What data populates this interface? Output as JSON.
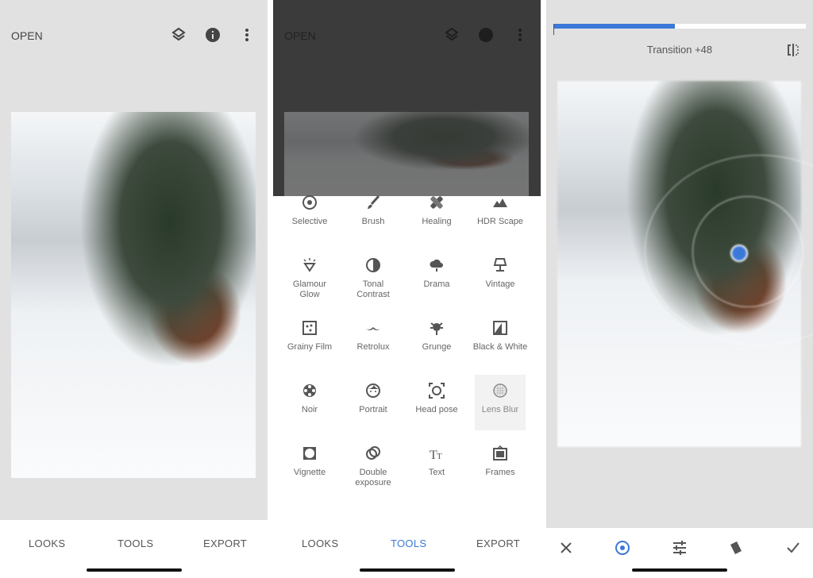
{
  "panel1": {
    "open_label": "OPEN",
    "tabs": [
      "LOOKS",
      "TOOLS",
      "EXPORT"
    ],
    "icons": [
      "layers-icon",
      "info-icon",
      "more-vert-icon"
    ]
  },
  "panel2": {
    "open_label": "OPEN",
    "tabs": [
      "LOOKS",
      "TOOLS",
      "EXPORT"
    ],
    "active_tab": "TOOLS",
    "tools": [
      {
        "label": "Selective",
        "icon": "selective-icon"
      },
      {
        "label": "Brush",
        "icon": "brush-icon"
      },
      {
        "label": "Healing",
        "icon": "healing-icon"
      },
      {
        "label": "HDR Scape",
        "icon": "mountains-icon"
      },
      {
        "label": "Glamour Glow",
        "icon": "diamond-icon"
      },
      {
        "label": "Tonal Contrast",
        "icon": "tonal-icon"
      },
      {
        "label": "Drama",
        "icon": "cloud-icon"
      },
      {
        "label": "Vintage",
        "icon": "lamp-icon"
      },
      {
        "label": "Grainy Film",
        "icon": "grain-icon"
      },
      {
        "label": "Retrolux",
        "icon": "mustache-icon"
      },
      {
        "label": "Grunge",
        "icon": "grunge-icon"
      },
      {
        "label": "Black & White",
        "icon": "bw-icon"
      },
      {
        "label": "Noir",
        "icon": "film-reel-icon"
      },
      {
        "label": "Portrait",
        "icon": "face-icon"
      },
      {
        "label": "Head pose",
        "icon": "face-frame-icon"
      },
      {
        "label": "Lens Blur",
        "icon": "lens-blur-icon"
      },
      {
        "label": "Vignette",
        "icon": "vignette-icon"
      },
      {
        "label": "Double exposure",
        "icon": "double-exposure-icon"
      },
      {
        "label": "Text",
        "icon": "text-icon"
      },
      {
        "label": "Frames",
        "icon": "frame-icon"
      }
    ],
    "selected_tool": "Lens Blur"
  },
  "panel3": {
    "slider_label": "Transition +48",
    "slider_value": 48,
    "slider_min": 0,
    "slider_max": 100,
    "accent": "#3c78d8",
    "bottom_icons": [
      "close-icon",
      "blur-shape-icon",
      "adjust-icon",
      "style-icon",
      "check-icon"
    ]
  }
}
